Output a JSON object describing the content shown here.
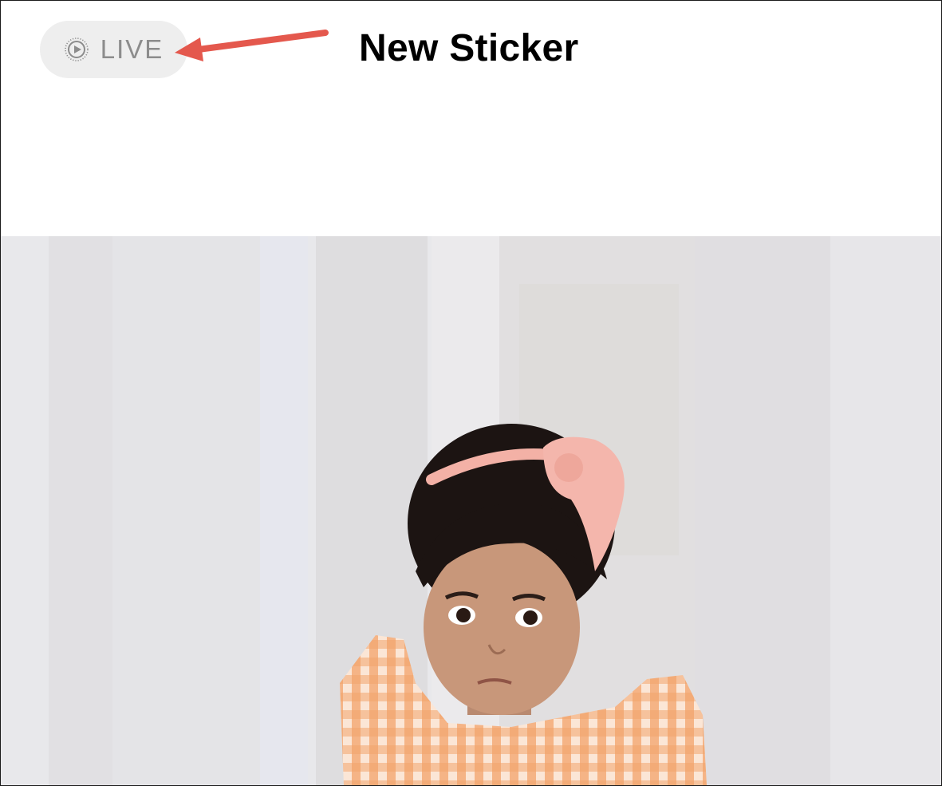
{
  "header": {
    "live_label": "LIVE",
    "title": "New Sticker"
  },
  "icons": {
    "live": "live-photo-icon",
    "annotation": "annotation-arrow"
  },
  "colors": {
    "pill_bg": "#eeeeee",
    "pill_text": "#8c8c8c",
    "arrow": "#e4584d",
    "backdrop": "#e7e7ea",
    "dress": "#f2a36b",
    "bow": "#f4b6ac"
  },
  "photo": {
    "subject": "child-sticker"
  }
}
